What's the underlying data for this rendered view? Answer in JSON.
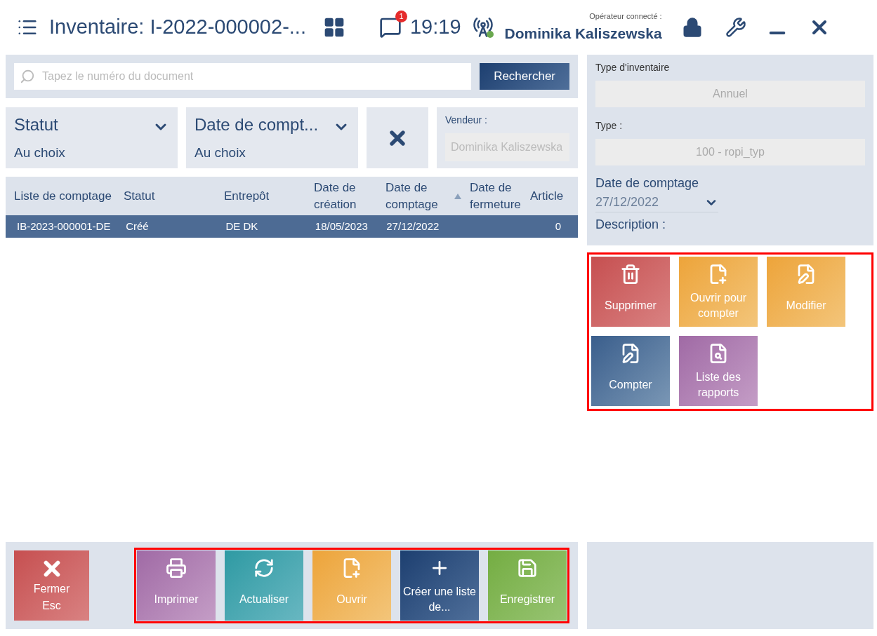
{
  "header": {
    "title": "Inventaire: I-2022-000002-...",
    "notifications": "1",
    "time": "19:19",
    "operator_label": "Opérateur connecté :",
    "operator": "Dominika Kaliszewska"
  },
  "search": {
    "placeholder": "Tapez le numéro du document",
    "button": "Rechercher"
  },
  "filters": [
    {
      "label": "Statut",
      "value": "Au choix"
    },
    {
      "label": "Date de compt...",
      "value": "Au choix"
    }
  ],
  "seller": {
    "label": "Vendeur :",
    "value": "Dominika Kaliszewska"
  },
  "table": {
    "columns": [
      {
        "label": "Liste de comptage",
        "sorted": false
      },
      {
        "label": "Statut",
        "sorted": false
      },
      {
        "label": "Entrepôt",
        "sorted": false
      },
      {
        "label": "Date de création",
        "sorted": false
      },
      {
        "label": "Date de comptage",
        "sorted": true
      },
      {
        "label": "Date de fermeture",
        "sorted": false
      },
      {
        "label": "Article",
        "sorted": false
      }
    ],
    "rows": [
      {
        "selected": true,
        "cells": [
          "IB-2023-000001-DE",
          "Créé",
          "DE DK",
          "18/05/2023",
          "27/12/2022",
          "",
          "0"
        ]
      }
    ]
  },
  "details": {
    "inventory_type_label": "Type d'inventaire",
    "inventory_type": "Annuel",
    "type_label": "Type :",
    "type": "100 - ropi_typ",
    "date_label": "Date de comptage",
    "date": "27/12/2022",
    "description_label": "Description :"
  },
  "actions": [
    {
      "label": "Supprimer",
      "kind": "delete"
    },
    {
      "label": "Ouvrir pour compter",
      "kind": "open"
    },
    {
      "label": "Modifier",
      "kind": "edit"
    },
    {
      "label": "Compter",
      "kind": "count"
    },
    {
      "label": "Liste des rapports",
      "kind": "reports"
    }
  ],
  "close_button": {
    "label": "Fermer",
    "shortcut": "Esc"
  },
  "bottom_actions": [
    {
      "label": "Imprimer",
      "kind": "print"
    },
    {
      "label": "Actualiser",
      "kind": "refresh"
    },
    {
      "label": "Ouvrir",
      "kind": "open"
    },
    {
      "label": "Créer une liste de...",
      "kind": "create"
    },
    {
      "label": "Enregistrer",
      "kind": "save"
    }
  ]
}
